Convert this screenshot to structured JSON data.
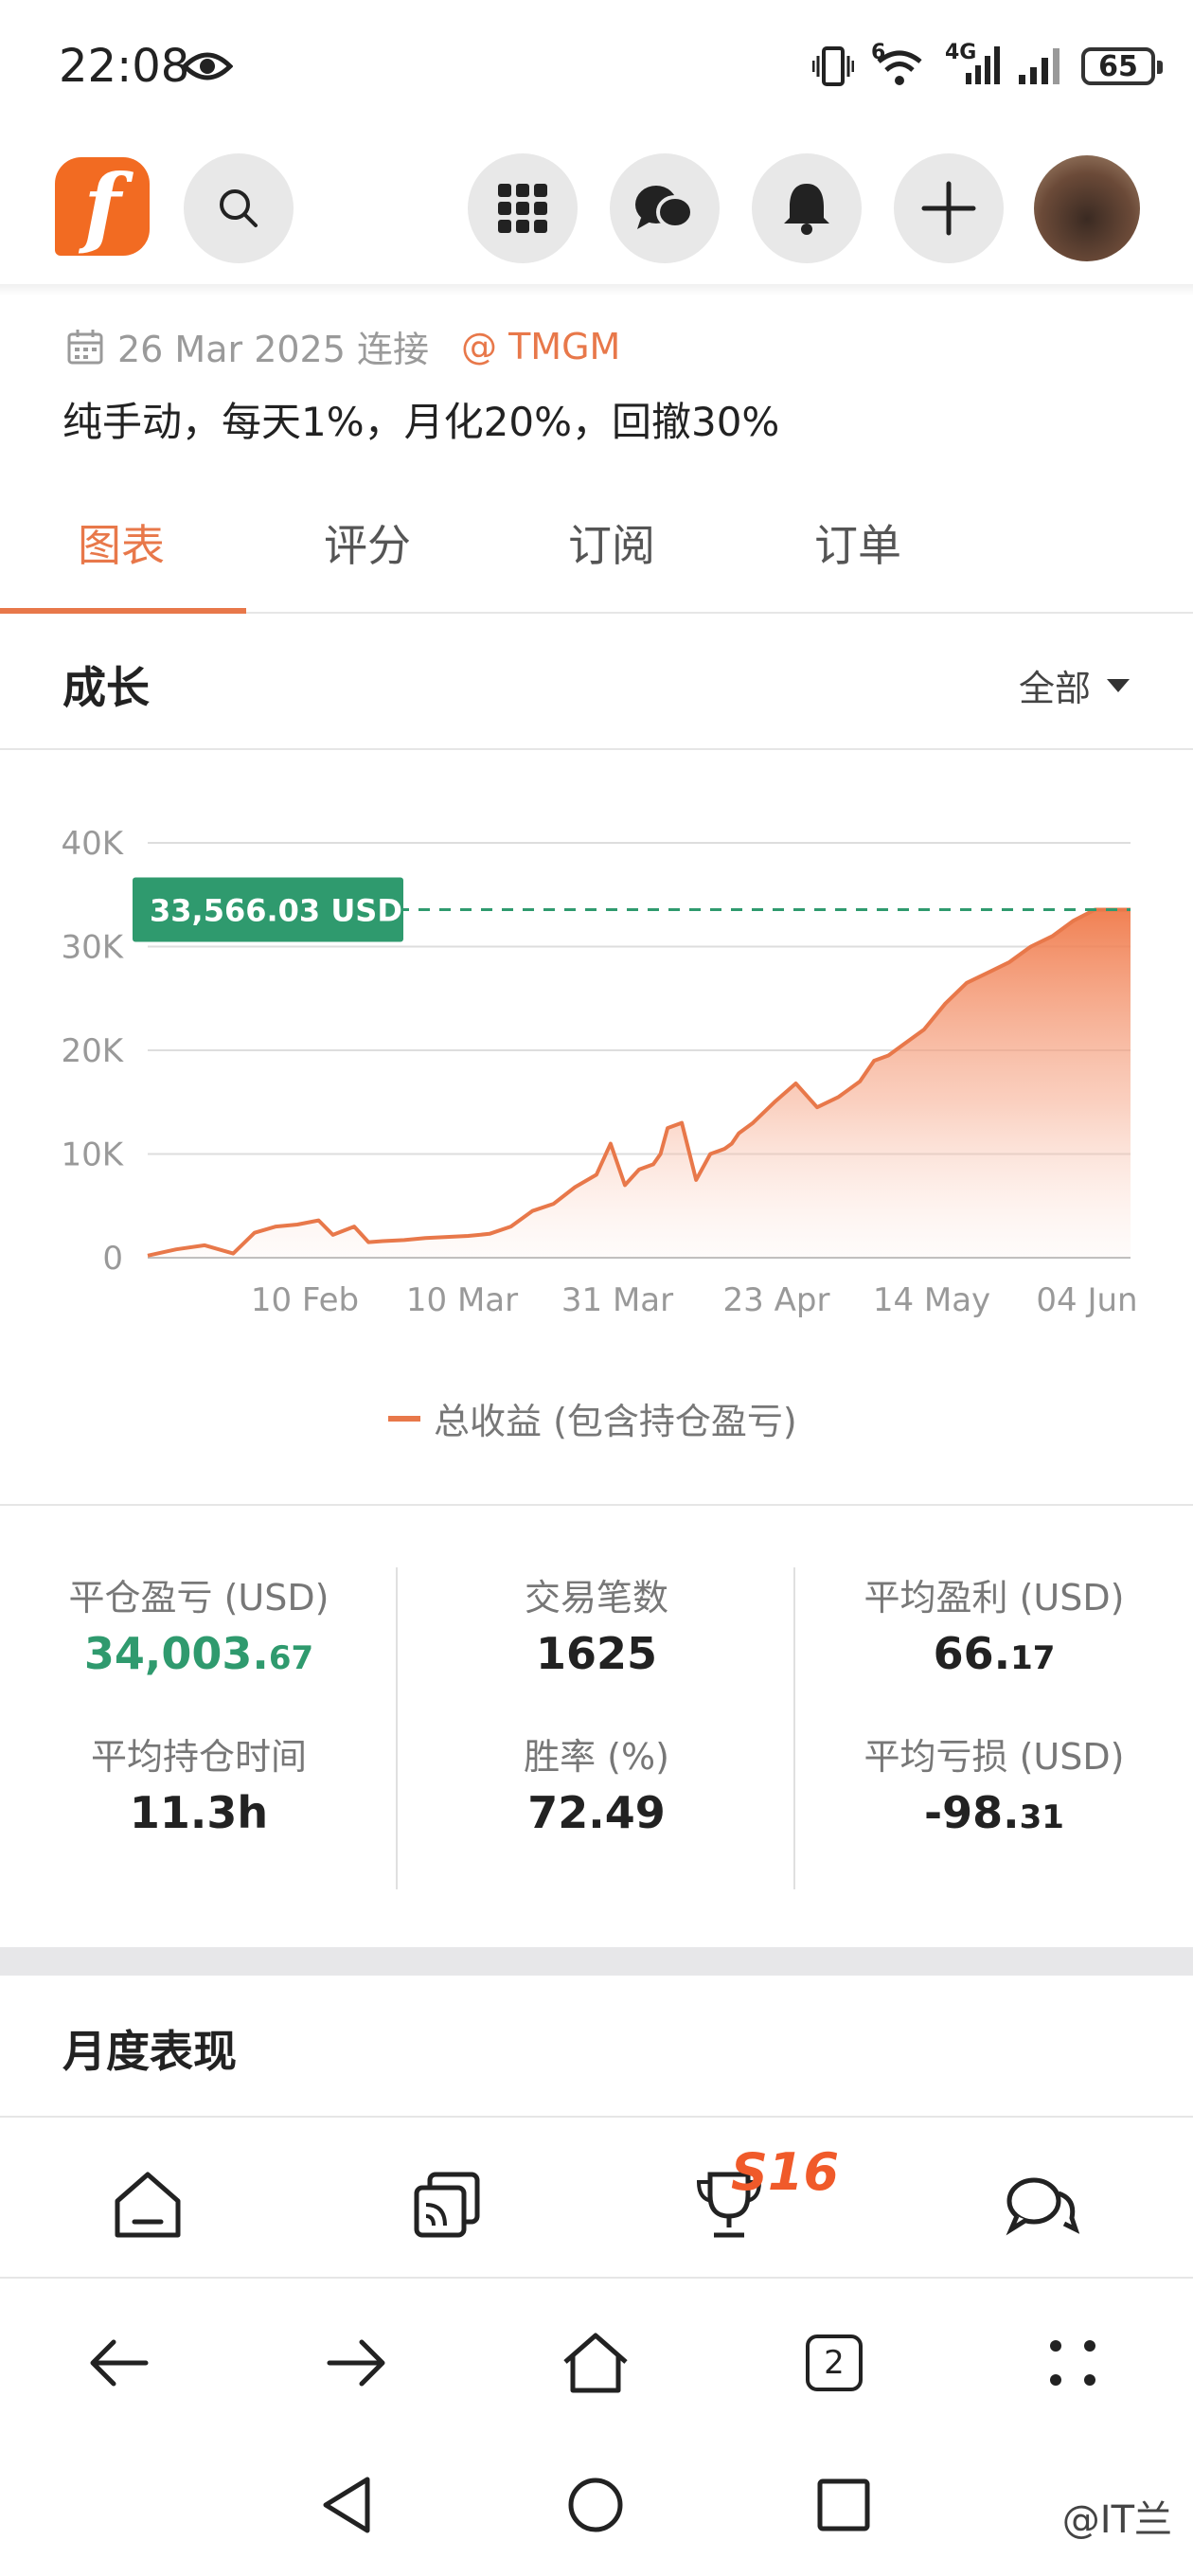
{
  "status_bar": {
    "time": "22:08",
    "network": "4G",
    "wifi_sub": "6",
    "battery": "65"
  },
  "header": {
    "logo_letter": "f",
    "icons": [
      "search-icon",
      "apps-grid-icon",
      "chat-icon",
      "bell-icon",
      "plus-icon"
    ]
  },
  "meta": {
    "date": "26 Mar 2025 连接",
    "broker": "@ TMGM",
    "description": "纯手动，每天1%，月化20%，回撤30%"
  },
  "tabs": [
    {
      "label": "图表",
      "active": true
    },
    {
      "label": "评分",
      "active": false
    },
    {
      "label": "订阅",
      "active": false
    },
    {
      "label": "订单",
      "active": false
    }
  ],
  "growth": {
    "title": "成长",
    "range": "全部"
  },
  "chart_data": {
    "type": "area",
    "current_label": "33,566.03 USD",
    "yticks": [
      "40K",
      "30K",
      "20K",
      "10K",
      "0"
    ],
    "ylim": [
      0,
      40000
    ],
    "xticks": [
      "10 Feb",
      "10 Mar",
      "31 Mar",
      "23 Apr",
      "14 May",
      "04 Jun"
    ],
    "legend": "总收益 (包含持仓盈亏)",
    "series": [
      {
        "name": "总收益 (包含持仓盈亏)",
        "x": [
          "2025-01-20",
          "2025-01-24",
          "2025-01-28",
          "2025-02-01",
          "2025-02-04",
          "2025-02-07",
          "2025-02-10",
          "2025-02-13",
          "2025-02-15",
          "2025-02-18",
          "2025-02-20",
          "2025-02-22",
          "2025-02-25",
          "2025-02-28",
          "2025-03-03",
          "2025-03-06",
          "2025-03-09",
          "2025-03-12",
          "2025-03-15",
          "2025-03-18",
          "2025-03-21",
          "2025-03-24",
          "2025-03-26",
          "2025-03-28",
          "2025-03-30",
          "2025-04-01",
          "2025-04-02",
          "2025-04-03",
          "2025-04-05",
          "2025-04-07",
          "2025-04-09",
          "2025-04-11",
          "2025-04-12",
          "2025-04-13",
          "2025-04-15",
          "2025-04-18",
          "2025-04-21",
          "2025-04-24",
          "2025-04-27",
          "2025-04-30",
          "2025-05-02",
          "2025-05-04",
          "2025-05-06",
          "2025-05-09",
          "2025-05-12",
          "2025-05-15",
          "2025-05-18",
          "2025-05-21",
          "2025-05-24",
          "2025-05-27",
          "2025-05-30",
          "2025-06-02",
          "2025-06-05",
          "2025-06-07"
        ],
        "values": [
          200,
          800,
          1200,
          400,
          2400,
          3000,
          3200,
          3600,
          2200,
          3000,
          1500,
          1600,
          1700,
          1900,
          2000,
          2100,
          2300,
          3000,
          4500,
          5200,
          6800,
          8000,
          11000,
          7000,
          8500,
          9000,
          10000,
          12500,
          13000,
          7500,
          10000,
          10500,
          11000,
          12000,
          13000,
          15000,
          16800,
          14500,
          15500,
          17000,
          19000,
          19500,
          20500,
          22000,
          24500,
          26500,
          27500,
          28500,
          30000,
          31000,
          32500,
          33566,
          33566,
          33566
        ]
      }
    ]
  },
  "stats": [
    {
      "label": "平仓盈亏 (USD)",
      "int": "34,003.",
      "dec": "67",
      "color": "green"
    },
    {
      "label": "交易笔数",
      "int": "1625",
      "dec": ""
    },
    {
      "label": "平均盈利 (USD)",
      "int": "66.",
      "dec": "17"
    },
    {
      "label": "平均持仓时间",
      "int": "11.3h",
      "dec": ""
    },
    {
      "label": "胜率 (%)",
      "int": "72.49",
      "dec": ""
    },
    {
      "label": "平均亏损 (USD)",
      "int": "-98.",
      "dec": "31"
    }
  ],
  "monthly": {
    "title": "月度表现"
  },
  "bottom_nav": {
    "badge": "S16"
  },
  "browser": {
    "tab_count": "2"
  },
  "watermark": "@IT兰"
}
